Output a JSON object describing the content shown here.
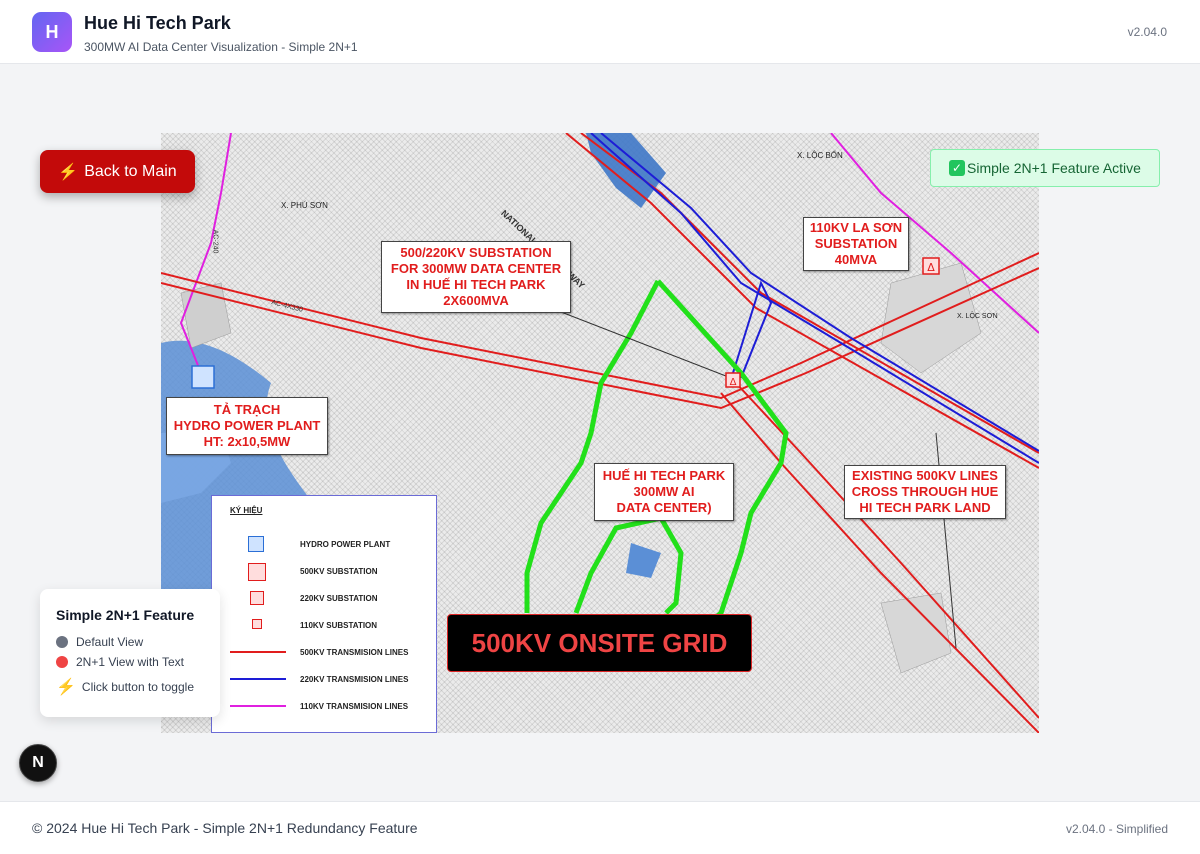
{
  "header": {
    "logo_letter": "H",
    "title": "Hue Hi Tech Park",
    "subtitle": "300MW AI Data Center Visualization - Simple 2N+1",
    "version": "v2.04.0"
  },
  "back_button": {
    "label": "Back to Main",
    "icon": "lightning-icon"
  },
  "feature_badge": {
    "label": "Simple 2N+1 Feature Active",
    "icon": "checkmark-icon"
  },
  "map": {
    "labels": {
      "phu_son": "X. PHÚ SƠN",
      "loc_bon": "X. LỘC BỔN",
      "loc_son": "X. LỘC SƠN",
      "expressway": "NATIONAL EXPRESSWAY",
      "ac240": "AC-240",
      "ac4x330": "AC-4X330"
    },
    "callouts": {
      "substation_500": "500/220KV SUBSTATION\nFOR 300MW DATA CENTER\nIN HUẾ HI TECH PARK\n2X600MVA",
      "la_son": "110KV LA SƠN\nSUBSTATION\n40MVA",
      "hydro": "TẢ TRẠCH\nHYDRO POWER PLANT\nHT: 2x10,5MW",
      "hue_park": "HUẾ HI TECH PARK\n300MW AI\nDATA CENTER)",
      "existing_lines": "EXISTING 500KV LINES\nCROSS THROUGH HUE\nHI TECH PARK LAND"
    },
    "legend": {
      "title": "KÝ HIỆU",
      "items": [
        {
          "label": "HYDRO POWER PLANT"
        },
        {
          "label": "500KV SUBSTATION"
        },
        {
          "label": "220KV SUBSTATION"
        },
        {
          "label": "110KV SUBSTATION"
        },
        {
          "label": "500KV TRANSMISION LINES",
          "color": "#e11d1d"
        },
        {
          "label": "220KV TRANSMISION LINES",
          "color": "#1d1dd6"
        },
        {
          "label": "110KV TRANSMISION LINES",
          "color": "#e020e0"
        }
      ]
    },
    "grid_banner": "500KV ONSITE GRID"
  },
  "panel": {
    "title": "Simple 2N+1 Feature",
    "items": [
      {
        "label": "Default View",
        "color": "#6b7280"
      },
      {
        "label": "2N+1 View with Text",
        "color": "#ef4444"
      },
      {
        "label": "Click button to toggle",
        "icon": "lightning-icon"
      }
    ]
  },
  "next_badge": "N",
  "footer": {
    "text": "© 2024 Hue Hi Tech Park - Simple 2N+1 Redundancy Feature",
    "version": "v2.04.0 - Simplified"
  },
  "colors": {
    "accent_red": "#c30a0a",
    "boundary_green": "#22e01a",
    "line_500kv": "#e11d1d",
    "line_220kv": "#1d1dd6",
    "line_110kv": "#e020e0"
  }
}
